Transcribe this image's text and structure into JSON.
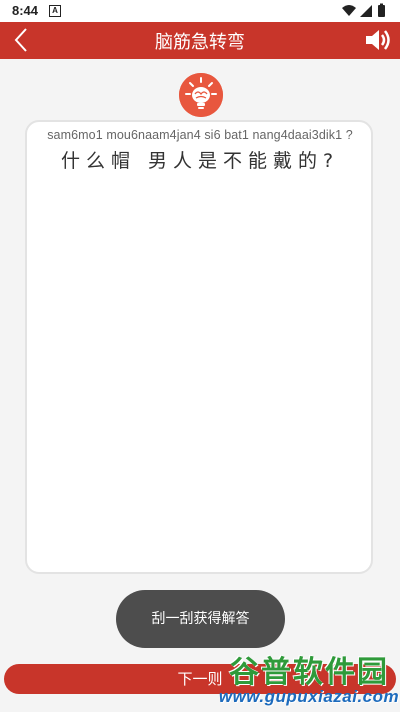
{
  "status_bar": {
    "time": "8:44",
    "notif_badge": "A",
    "icons": [
      "wifi-icon",
      "signal-icon",
      "battery-icon"
    ]
  },
  "app_bar": {
    "title": "脑筋急转弯",
    "back_icon": "chevron-left-icon",
    "sound_icon": "speaker-icon",
    "color": "#c8352a"
  },
  "question": {
    "pinyin": "sam6mo1 mou6naam4jan4 si6 bat1 nang4daai3dik1 ?",
    "text": "什么帽 男人是不能戴的?"
  },
  "buttons": {
    "reveal_label": "刮一刮获得解答",
    "next_label": "下一则"
  },
  "watermark": {
    "title": "谷普软件园",
    "url": "www.gupuxiazai.com"
  }
}
